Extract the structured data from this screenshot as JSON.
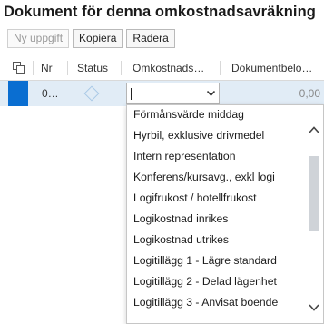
{
  "page_title": "Dokument för denna omkostnadsavräkning",
  "toolbar": {
    "new_label": "Ny uppgift",
    "copy_label": "Kopiera",
    "delete_label": "Radera"
  },
  "table": {
    "columns": [
      "Nr",
      "Status",
      "Omkostnads…",
      "Dokumentbelo…"
    ],
    "row": {
      "nr": "0…",
      "expense_type": "",
      "amount": "0,00"
    }
  },
  "dropdown": {
    "options": [
      "Förmånsvärde middag",
      "Hyrbil, exklusive drivmedel",
      "Intern representation",
      "Konferens/kursavg., exkl logi",
      "Logifrukost / hotellfrukost",
      "Logikostnad inrikes",
      "Logikostnad utrikes",
      "Logitillägg 1 - Lägre standard",
      "Logitillägg 2 - Delad lägenhet",
      "Logitillägg 3 - Anvisat boende"
    ]
  },
  "colors": {
    "accent": "#0a6ed1",
    "selected_row": "#e1ecf6"
  },
  "icons": {
    "copy_rows": "copy-icon",
    "status": "diamond-icon",
    "select_open": "chevron-down-icon",
    "scroll_up": "chevron-up-icon",
    "scroll_down": "chevron-down-icon"
  }
}
